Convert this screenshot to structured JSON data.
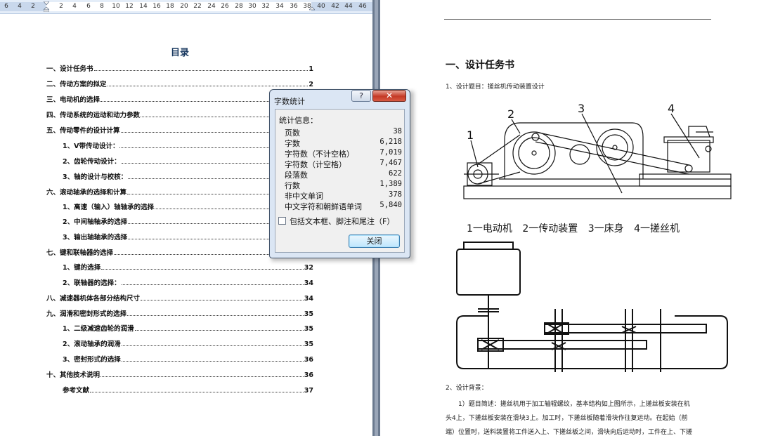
{
  "ruler": {
    "left_ticks": [
      "6",
      "4",
      "2",
      "2",
      "4",
      "6",
      "8",
      "10",
      "12",
      "14",
      "16",
      "18",
      "20",
      "22",
      "24",
      "26",
      "28",
      "30",
      "32",
      "34",
      "36",
      "38",
      "40",
      "42",
      "44",
      "46"
    ]
  },
  "toc": {
    "title": "目录",
    "entries": [
      {
        "label": "一、设计任务书",
        "page": "1",
        "level": "top"
      },
      {
        "label": "二、传动方案的拟定",
        "page": "2",
        "level": "top"
      },
      {
        "label": "三、电动机的选择",
        "page": "",
        "level": "top"
      },
      {
        "label": "四、传动系统的运动和动力参数",
        "page": "",
        "level": "top"
      },
      {
        "label": "五、传动零件的设计计算",
        "page": "",
        "level": "top"
      },
      {
        "label": "1、V带传动设计：",
        "page": "",
        "level": "sub"
      },
      {
        "label": "2、齿轮传动设计：",
        "page": "",
        "level": "sub"
      },
      {
        "label": "3、轴的设计与校核：",
        "page": "",
        "level": "sub"
      },
      {
        "label": "六、滚动轴承的选择和计算",
        "page": "",
        "level": "top"
      },
      {
        "label": "1、高速（输入）轴轴承的选择",
        "page": "",
        "level": "sub"
      },
      {
        "label": "2、中间轴轴承的选择",
        "page": "",
        "level": "sub"
      },
      {
        "label": "3、输出轴轴承的选择",
        "page": "",
        "level": "sub"
      },
      {
        "label": "七、键和联轴器的选择",
        "page": "",
        "level": "top"
      },
      {
        "label": "1、键的选择",
        "page": "32",
        "level": "sub"
      },
      {
        "label": "2、联轴器的选择：",
        "page": "34",
        "level": "sub"
      },
      {
        "label": "八、减速器机体各部分结构尺寸",
        "page": "34",
        "level": "top"
      },
      {
        "label": "九、润滑和密封形式的选择",
        "page": "35",
        "level": "top"
      },
      {
        "label": "1、二级减速齿轮的润滑",
        "page": "35",
        "level": "sub"
      },
      {
        "label": "2、滚动轴承的润滑",
        "page": "35",
        "level": "sub"
      },
      {
        "label": "3、密封形式的选择",
        "page": "36",
        "level": "sub"
      },
      {
        "label": "十、其他技术说明",
        "page": "36",
        "level": "top"
      },
      {
        "label": "参考文献",
        "page": "37",
        "level": "ref"
      }
    ]
  },
  "right_page": {
    "heading": "一、设计任务书",
    "line1": "1、设计题目：搓丝机传动装置设计",
    "diagram_labels": [
      "1",
      "2",
      "3",
      "4"
    ],
    "caption": "1一电动机  2一传动装置  3一床身  4一搓丝机",
    "line2": "2、设计背景：",
    "para1": "1）题目简述：搓丝机用于加工轴辊螺纹，基本结构如上图所示，上搓丝板安装在机",
    "para2": "头4上，下搓丝板安装在滑块3上。加工时，下搓丝板随着滑块作往复运动。在起始（前",
    "para3": "端）位置时，送料装置将工件送入上、下搓丝板之间，滑块向后运动时，工件在上、下搓"
  },
  "dialog": {
    "title": "字数统计",
    "help_label": "?",
    "close_x": "✕",
    "section_label": "统计信息：",
    "stats": [
      {
        "name": "页数",
        "value": "38"
      },
      {
        "name": "字数",
        "value": "6,218"
      },
      {
        "name": "字符数（不计空格）",
        "value": "7,019"
      },
      {
        "name": "字符数（计空格）",
        "value": "7,467"
      },
      {
        "name": "段落数",
        "value": "622"
      },
      {
        "name": "行数",
        "value": "1,389"
      },
      {
        "name": "非中文单词",
        "value": "378"
      },
      {
        "name": "中文字符和朝鲜语单词",
        "value": "5,840"
      }
    ],
    "checkbox_label": "包括文本框、脚注和尾注（F）",
    "checkbox_checked": false,
    "close_button": "关闭"
  }
}
